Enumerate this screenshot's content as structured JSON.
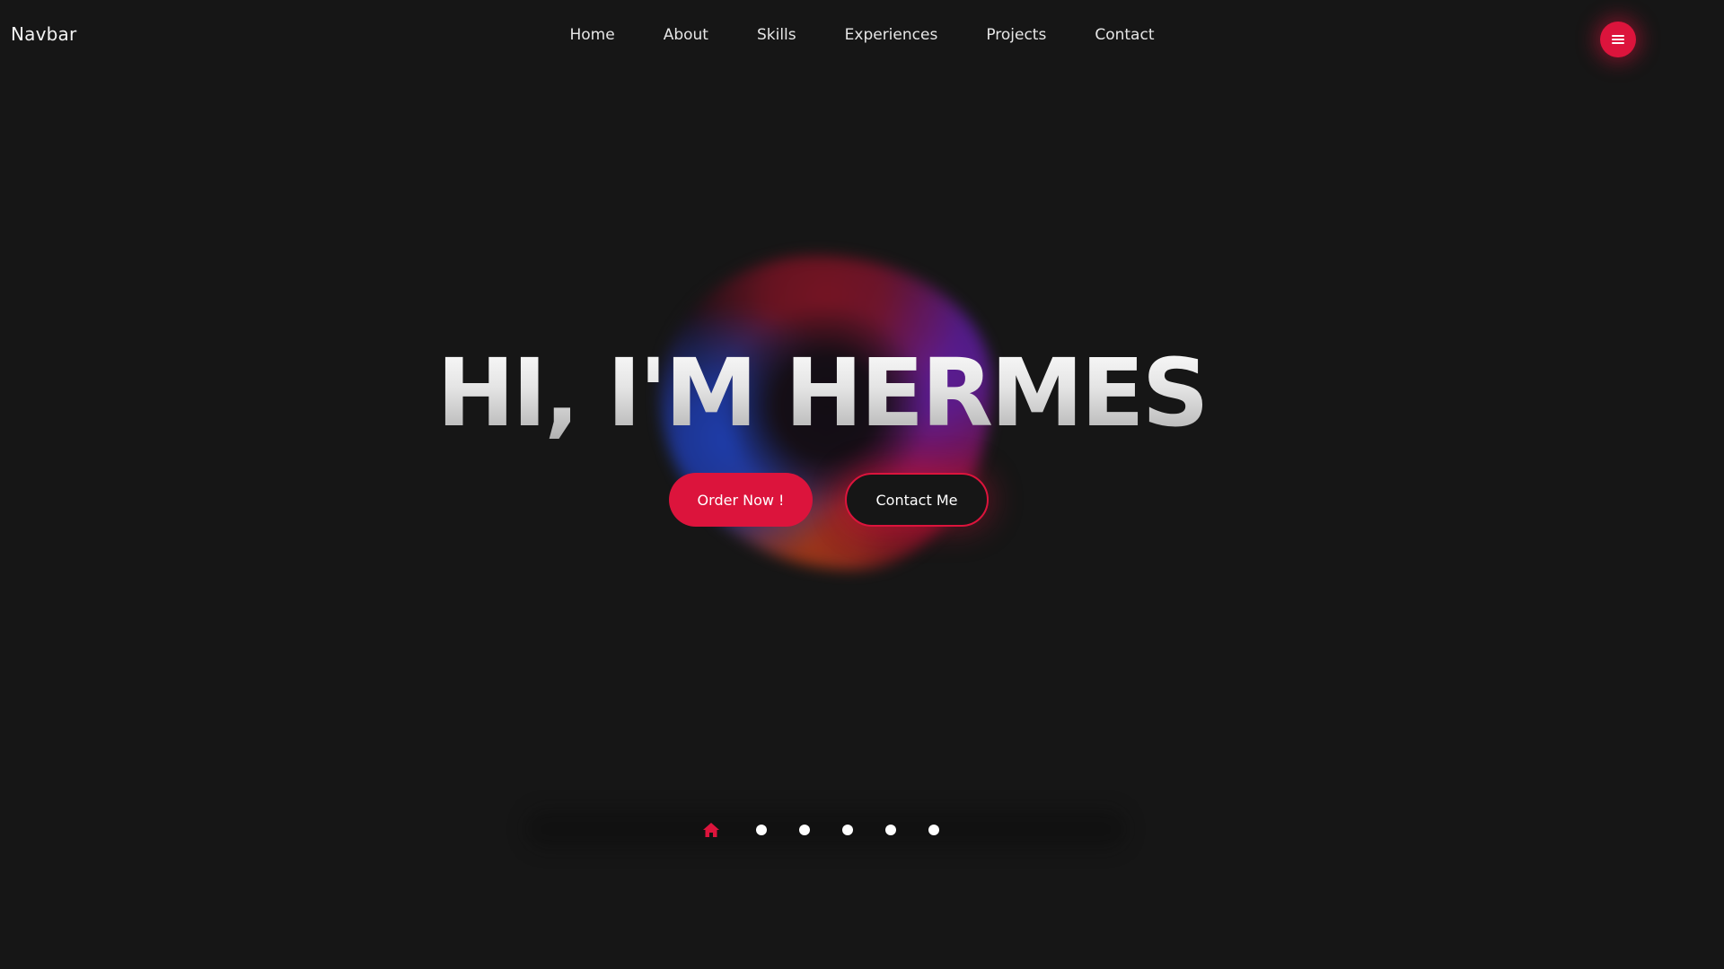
{
  "navbar": {
    "brand": "Navbar",
    "links": [
      {
        "label": "Home"
      },
      {
        "label": "About"
      },
      {
        "label": "Skills"
      },
      {
        "label": "Experiences"
      },
      {
        "label": "Projects"
      },
      {
        "label": "Contact"
      }
    ],
    "menu_icon": "hamburger-menu-icon"
  },
  "hero": {
    "title": "HI, I'M HERMES",
    "order_button": "Order Now !",
    "contact_button": "Contact Me"
  },
  "dot_nav": {
    "active_icon": "home-icon",
    "dots": 5,
    "active_index": 0
  },
  "colors": {
    "background": "#161616",
    "accent": "#dc143c",
    "text": "#ffffff"
  }
}
